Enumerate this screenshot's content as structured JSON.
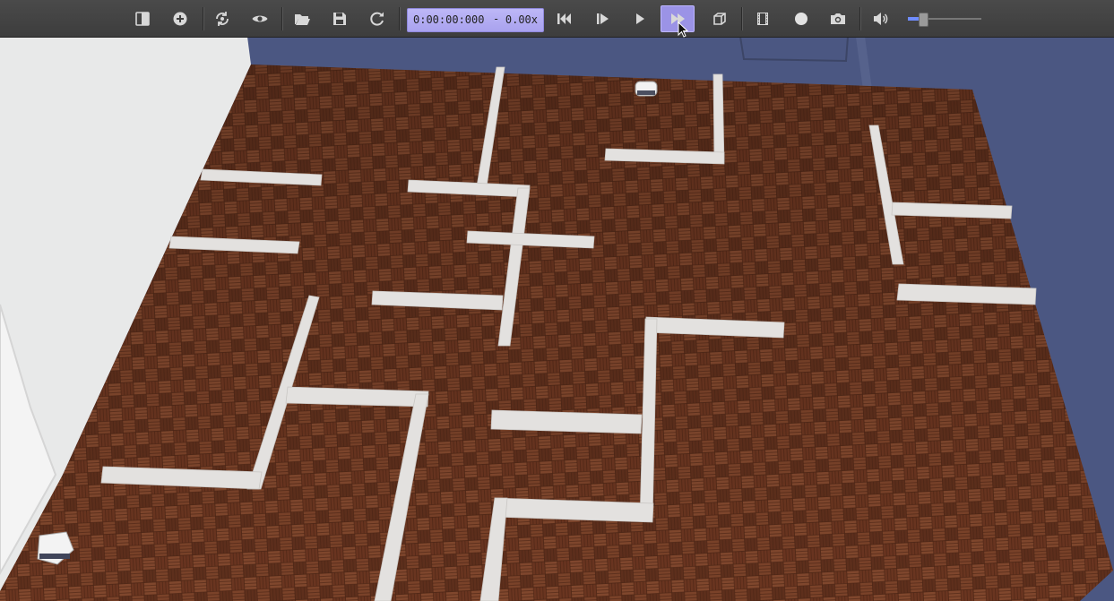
{
  "window": {
    "title": ""
  },
  "toolbar": {
    "buttons": [
      {
        "id": "toggle-scene-tree",
        "icon": "scene-tree-toggle-icon"
      },
      {
        "id": "add-node",
        "icon": "plus-circle-icon"
      },
      {
        "id": "reset-view",
        "icon": "rotate-view-icon"
      },
      {
        "id": "view-options",
        "icon": "eye-icon"
      },
      {
        "id": "open-world",
        "icon": "folder-open-icon"
      },
      {
        "id": "save-world",
        "icon": "floppy-disk-icon"
      },
      {
        "id": "reload-world",
        "icon": "reload-icon"
      },
      {
        "id": "reset-simulation",
        "icon": "skip-back-icon"
      },
      {
        "id": "step",
        "icon": "step-icon"
      },
      {
        "id": "run-realtime",
        "icon": "play-icon"
      },
      {
        "id": "run-fast",
        "icon": "fast-forward-icon"
      },
      {
        "id": "render-toggle",
        "icon": "cube-icon"
      },
      {
        "id": "record-movie",
        "icon": "film-strip-icon"
      },
      {
        "id": "record-animation",
        "icon": "circle-record-icon"
      },
      {
        "id": "take-screenshot",
        "icon": "camera-icon"
      },
      {
        "id": "sound",
        "icon": "speaker-icon"
      }
    ],
    "simulation_time": "0:00:00:000",
    "time_separator": "-",
    "speed_factor": "0.00x",
    "active_button": "run-fast",
    "volume_level": 0.2
  },
  "scene": {
    "description_icon": "3d-maze-arena",
    "colors": {
      "background": "#4a5680",
      "floor_dark": "#5c2f1c",
      "floor_light": "#8a4e33",
      "wall": "#e6e4e2",
      "room_wall": "#e9eaea"
    }
  }
}
